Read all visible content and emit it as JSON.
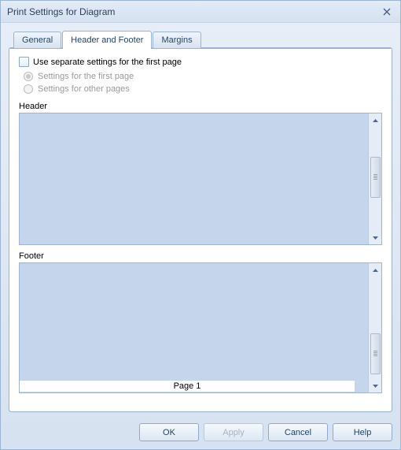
{
  "window": {
    "title": "Print Settings for Diagram"
  },
  "tabs": {
    "general": "General",
    "header_footer": "Header and Footer",
    "margins": "Margins"
  },
  "options": {
    "use_separate": "Use separate settings for the first page",
    "settings_first": "Settings for the first page",
    "settings_other": "Settings for other pages"
  },
  "sections": {
    "header": "Header",
    "footer": "Footer"
  },
  "footer_page": "Page 1",
  "buttons": {
    "ok": "OK",
    "apply": "Apply",
    "cancel": "Cancel",
    "help": "Help"
  }
}
